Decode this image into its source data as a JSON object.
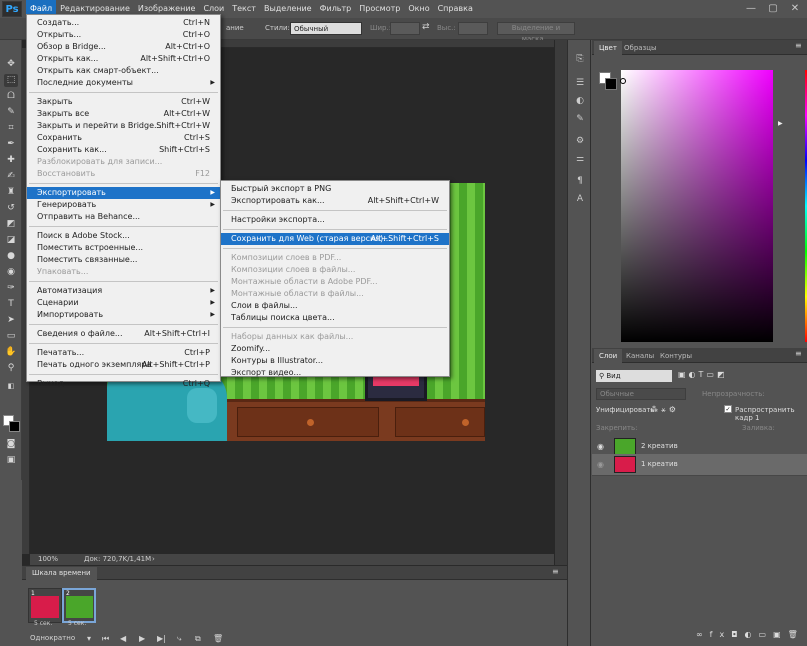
{
  "menubar": {
    "logo": "Ps",
    "items": [
      "Файл",
      "Редактирование",
      "Изображение",
      "Слои",
      "Текст",
      "Выделение",
      "Фильтр",
      "Просмотр",
      "Окно",
      "Справка"
    ],
    "controls": [
      "—",
      "▢",
      "✕"
    ]
  },
  "options": {
    "styles_label": "Стили:",
    "styles_value": "Обычный",
    "width_label": "Шир.:",
    "height_label": "Выс.:",
    "mask_button": "Выделение и маска...",
    "edge_label": "ание"
  },
  "file_menu": [
    {
      "label": "Создать...",
      "shortcut": "Ctrl+N"
    },
    {
      "label": "Открыть...",
      "shortcut": "Ctrl+O"
    },
    {
      "label": "Обзор в Bridge...",
      "shortcut": "Alt+Ctrl+O"
    },
    {
      "label": "Открыть как...",
      "shortcut": "Alt+Shift+Ctrl+O"
    },
    {
      "label": "Открыть как смарт-объект...",
      "shortcut": ""
    },
    {
      "label": "Последние документы",
      "shortcut": "",
      "sub": true
    },
    {
      "sep": true
    },
    {
      "label": "Закрыть",
      "shortcut": "Ctrl+W"
    },
    {
      "label": "Закрыть все",
      "shortcut": "Alt+Ctrl+W"
    },
    {
      "label": "Закрыть и перейти в Bridge...",
      "shortcut": "Shift+Ctrl+W"
    },
    {
      "label": "Сохранить",
      "shortcut": "Ctrl+S"
    },
    {
      "label": "Сохранить как...",
      "shortcut": "Shift+Ctrl+S"
    },
    {
      "label": "Разблокировать для записи...",
      "shortcut": "",
      "dis": true
    },
    {
      "label": "Восстановить",
      "shortcut": "F12",
      "dis": true
    },
    {
      "sep": true
    },
    {
      "label": "Экспортировать",
      "shortcut": "",
      "sub": true,
      "hl": true
    },
    {
      "label": "Генерировать",
      "shortcut": "",
      "sub": true
    },
    {
      "label": "Отправить на Behance...",
      "shortcut": ""
    },
    {
      "sep": true
    },
    {
      "label": "Поиск в Adobe Stock...",
      "shortcut": ""
    },
    {
      "label": "Поместить встроенные...",
      "shortcut": ""
    },
    {
      "label": "Поместить связанные...",
      "shortcut": ""
    },
    {
      "label": "Упаковать...",
      "shortcut": "",
      "dis": true
    },
    {
      "sep": true
    },
    {
      "label": "Автоматизация",
      "shortcut": "",
      "sub": true
    },
    {
      "label": "Сценарии",
      "shortcut": "",
      "sub": true
    },
    {
      "label": "Импортировать",
      "shortcut": "",
      "sub": true
    },
    {
      "sep": true
    },
    {
      "label": "Сведения о файле...",
      "shortcut": "Alt+Shift+Ctrl+I"
    },
    {
      "sep": true
    },
    {
      "label": "Печатать...",
      "shortcut": "Ctrl+P"
    },
    {
      "label": "Печать одного экземпляра",
      "shortcut": "Alt+Shift+Ctrl+P"
    },
    {
      "sep": true
    },
    {
      "label": "Выход",
      "shortcut": "Ctrl+Q"
    }
  ],
  "export_menu": [
    {
      "label": "Быстрый экспорт в PNG",
      "shortcut": ""
    },
    {
      "label": "Экспортировать как...",
      "shortcut": "Alt+Shift+Ctrl+W"
    },
    {
      "sep": true
    },
    {
      "label": "Настройки экспорта...",
      "shortcut": ""
    },
    {
      "sep": true
    },
    {
      "label": "Сохранить для Web (старая версия)...",
      "shortcut": "Alt+Shift+Ctrl+S",
      "hl": true
    },
    {
      "sep": true
    },
    {
      "label": "Композиции слоев в PDF...",
      "shortcut": "",
      "dis": true
    },
    {
      "label": "Композиции слоев в файлы...",
      "shortcut": "",
      "dis": true
    },
    {
      "label": "Монтажные области в Adobe PDF...",
      "shortcut": "",
      "dis": true
    },
    {
      "label": "Монтажные области в файлы...",
      "shortcut": "",
      "dis": true
    },
    {
      "label": "Слои в файлы...",
      "shortcut": ""
    },
    {
      "label": "Таблицы поиска цвета...",
      "shortcut": ""
    },
    {
      "sep": true
    },
    {
      "label": "Наборы данных как файлы...",
      "shortcut": "",
      "dis": true
    },
    {
      "label": "Zoomify...",
      "shortcut": ""
    },
    {
      "label": "Контуры в Illustrator...",
      "shortcut": ""
    },
    {
      "label": "Экспорт видео...",
      "shortcut": ""
    }
  ],
  "status": {
    "zoom": "100%",
    "doc": "Док: 720,7K/1,41M"
  },
  "timeline": {
    "tab": "Шкала времени",
    "frames": [
      {
        "num": "1",
        "time": "5 сек."
      },
      {
        "num": "2",
        "time": "5 сек."
      }
    ],
    "loop": "Однократно"
  },
  "color_panel": {
    "tabs": [
      "Цвет",
      "Образцы"
    ]
  },
  "layers_panel": {
    "tabs": [
      "Слои",
      "Каналы",
      "Контуры"
    ],
    "filter": "Вид",
    "blend": "Обычные",
    "opacity_label": "Непрозрачность:",
    "unify_label": "Унифицировать:",
    "propagate": "Распространить кадр 1",
    "lock_label": "Закрепить:",
    "fill_label": "Заливка:",
    "layers": [
      {
        "name": "2 креатив"
      },
      {
        "name": "1 креатив"
      }
    ]
  },
  "colors": {
    "accent": "#1e73c8",
    "canvas_green": "#59b42f",
    "brand": "#31a8ff"
  }
}
